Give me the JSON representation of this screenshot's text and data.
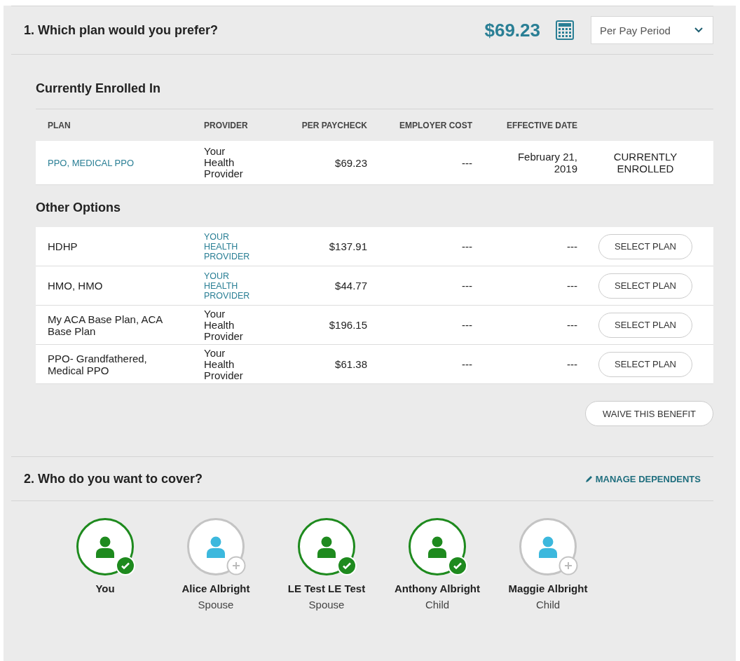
{
  "plan_section": {
    "title": "1. Which plan would you prefer?",
    "total": "$69.23",
    "period_select": {
      "value": "Per Pay Period"
    }
  },
  "current": {
    "heading": "Currently Enrolled In",
    "columns": [
      "PLAN",
      "PROVIDER",
      "PER PAYCHECK",
      "EMPLOYER COST",
      "EFFECTIVE DATE"
    ],
    "rows": [
      {
        "plan": "PPO, MEDICAL PPO",
        "provider": "Your Health Provider",
        "per_paycheck": "$69.23",
        "employer_cost": "---",
        "effective_date": "February 21, 2019",
        "status": "CURRENTLY ENROLLED"
      }
    ]
  },
  "other": {
    "heading": "Other Options",
    "rows": [
      {
        "plan": "HDHP",
        "provider": "YOUR HEALTH PROVIDER",
        "kind": "link",
        "per_paycheck": "$137.91",
        "employer_cost": "---",
        "effective_date": "---",
        "action": "SELECT PLAN"
      },
      {
        "plan": "HMO, HMO",
        "provider": "YOUR HEALTH PROVIDER",
        "kind": "link",
        "per_paycheck": "$44.77",
        "employer_cost": "---",
        "effective_date": "---",
        "action": "SELECT PLAN"
      },
      {
        "plan": "My ACA Base Plan, ACA Base Plan",
        "provider": "Your Health Provider",
        "kind": "text",
        "per_paycheck": "$196.15",
        "employer_cost": "---",
        "effective_date": "---",
        "action": "SELECT PLAN"
      },
      {
        "plan": "PPO- Grandfathered, Medical PPO",
        "provider": "Your Health Provider",
        "kind": "text",
        "per_paycheck": "$61.38",
        "employer_cost": "---",
        "effective_date": "---",
        "action": "SELECT PLAN"
      }
    ]
  },
  "waive_button": "WAIVE THIS BENEFIT",
  "cover_section": {
    "title": "2. Who do you want to cover?",
    "manage_link": "MANAGE DEPENDENTS",
    "people": [
      {
        "name": "You",
        "selected": true
      },
      {
        "name": "Alice Albright",
        "relation": "Spouse",
        "selected": false
      },
      {
        "name": "LE Test LE Test",
        "relation": "Spouse",
        "selected": true
      },
      {
        "name": "Anthony Albright",
        "relation": "Child",
        "selected": true
      },
      {
        "name": "Maggie Albright",
        "relation": "Child",
        "selected": false
      }
    ]
  }
}
